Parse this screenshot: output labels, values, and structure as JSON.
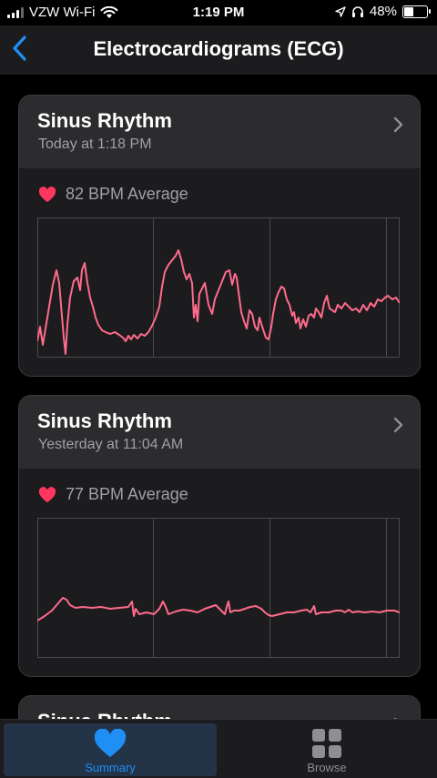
{
  "status_bar": {
    "carrier": "VZW Wi-Fi",
    "time": "1:19 PM",
    "battery": "48%",
    "battery_level": 0.48
  },
  "nav": {
    "title": "Electrocardiograms (ECG)"
  },
  "colors": {
    "accent": "#1f8ff5",
    "heart": "#ff375f",
    "ecg_line": "#ff6b8b"
  },
  "cards": [
    {
      "title": "Sinus Rhythm",
      "subtitle": "Today at 1:18 PM",
      "bpm": "82 BPM Average"
    },
    {
      "title": "Sinus Rhythm",
      "subtitle": "Yesterday at 11:04 AM",
      "bpm": "77 BPM Average"
    },
    {
      "title": "Sinus Rhythm"
    }
  ],
  "tabs": [
    {
      "label": "Summary",
      "icon": "heart-icon",
      "selected": true
    },
    {
      "label": "Browse",
      "icon": "grid-icon",
      "selected": false
    }
  ]
}
